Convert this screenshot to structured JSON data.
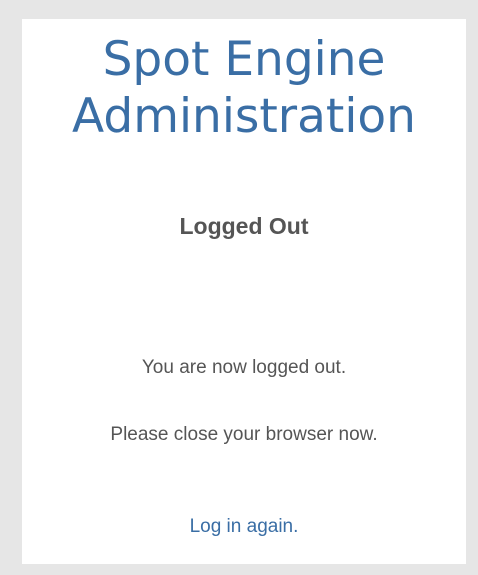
{
  "header": {
    "app_title_line1": "Spot Engine",
    "app_title_line2": "Administration"
  },
  "page": {
    "title": "Logged Out"
  },
  "messages": {
    "logged_out": "You are now logged out.",
    "close_browser": "Please close your browser now."
  },
  "actions": {
    "login_again": "Log in again."
  },
  "colors": {
    "background": "#e6e6e6",
    "panel": "#ffffff",
    "accent": "#3a6ea5",
    "text": "#555555"
  }
}
